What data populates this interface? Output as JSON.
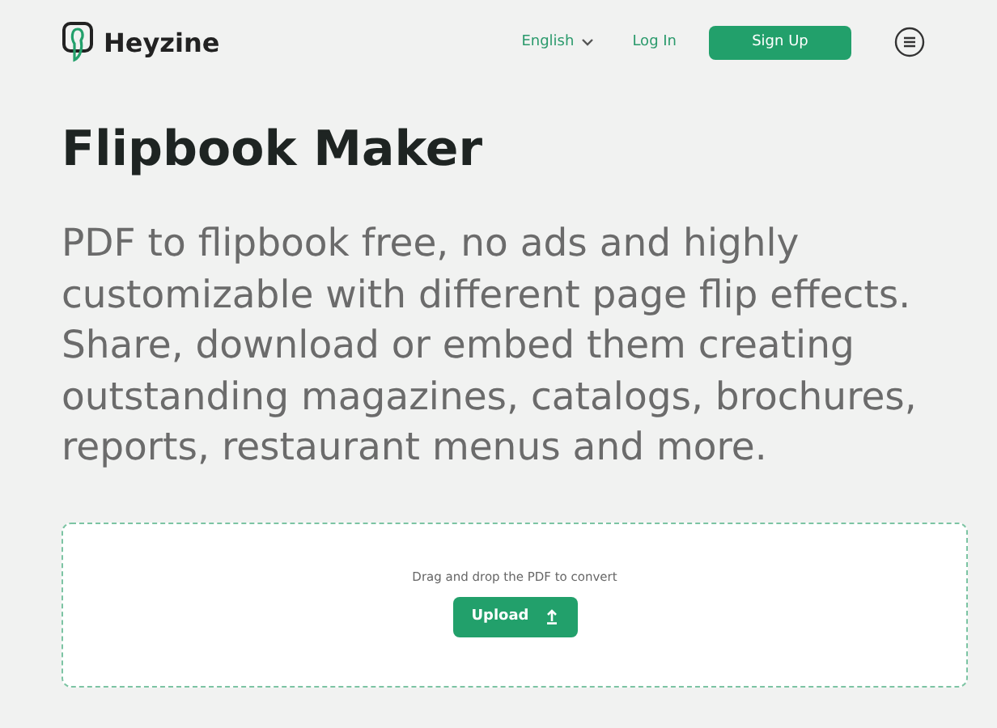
{
  "header": {
    "brand": "Heyzine",
    "language": "English",
    "login": "Log In",
    "signup": "Sign Up"
  },
  "hero": {
    "title": "Flipbook Maker",
    "description": "PDF to flipbook free, no ads and highly\ncustomizable with different page flip effects.\nShare, download or embed them creating\noutstanding magazines, catalogs, brochures,\nreports, restaurant menus and more."
  },
  "upload": {
    "hint": "Drag and drop the PDF to convert",
    "button": "Upload"
  }
}
